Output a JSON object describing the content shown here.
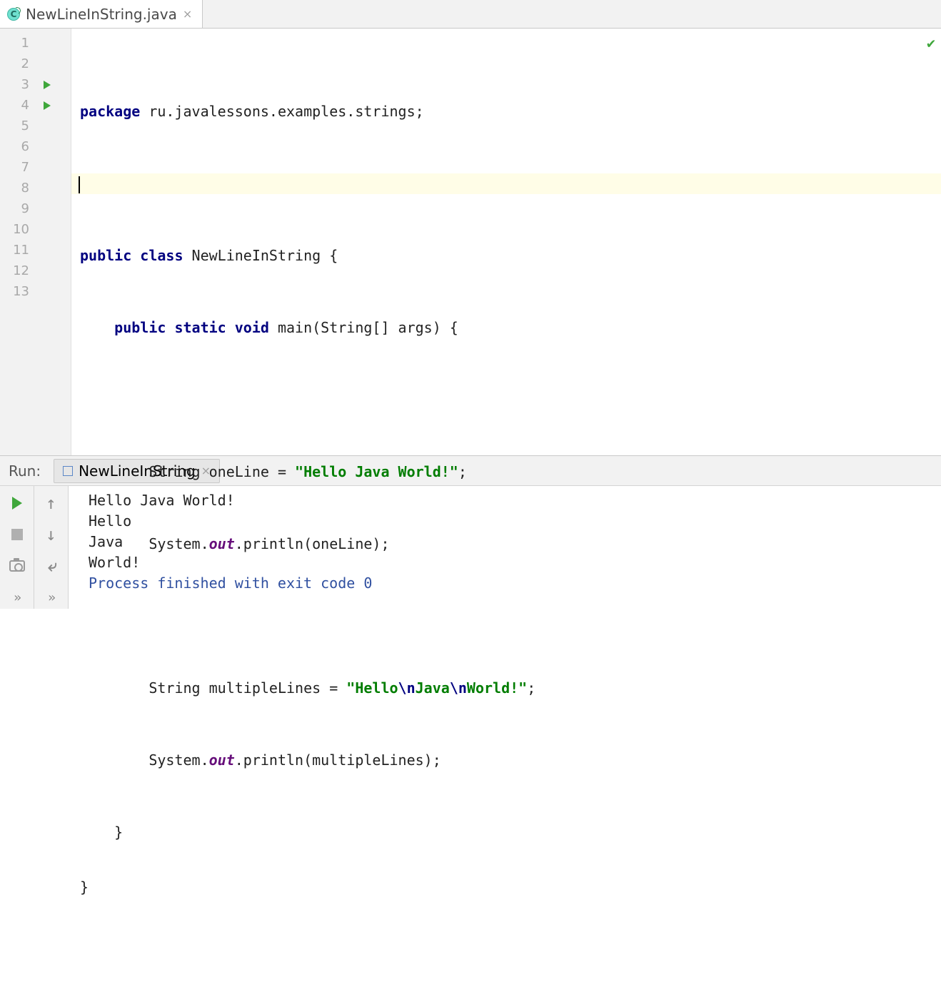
{
  "tab": {
    "fileName": "NewLineInString.java",
    "iconLetter": "C"
  },
  "editor": {
    "lineNumbers": [
      "1",
      "2",
      "3",
      "4",
      "5",
      "6",
      "7",
      "8",
      "9",
      "10",
      "11",
      "12",
      "13"
    ],
    "runMarkers": [
      3,
      4
    ],
    "currentLine": 2,
    "code": {
      "l1": {
        "kw1": "package",
        "rest": " ru.javalessons.examples.strings;"
      },
      "l3": {
        "kw1": "public class",
        "name": " NewLineInString {"
      },
      "l4": {
        "kw1": "public static void",
        "sig": " main(String[] args) {"
      },
      "l6": {
        "pre": "String oneLine = ",
        "str": "\"Hello Java World!\"",
        "post": ";"
      },
      "l7": {
        "pre": "System.",
        "fld": "out",
        "post": ".println(oneLine);"
      },
      "l9": {
        "pre": "String multipleLines = ",
        "q": "\"",
        "s1": "Hello",
        "e1": "\\n",
        "s2": "Java",
        "e2": "\\n",
        "s3": "World!",
        "q2": "\"",
        "post": ";"
      },
      "l10": {
        "pre": "System.",
        "fld": "out",
        "post": ".println(multipleLines);"
      },
      "l11": {
        "txt": "    }"
      },
      "l12": {
        "txt": "}"
      }
    }
  },
  "run": {
    "label": "Run:",
    "tabName": "NewLineInString",
    "output": [
      "Hello Java World!",
      "Hello",
      "Java",
      "World!",
      "",
      "Process finished with exit code 0"
    ]
  }
}
